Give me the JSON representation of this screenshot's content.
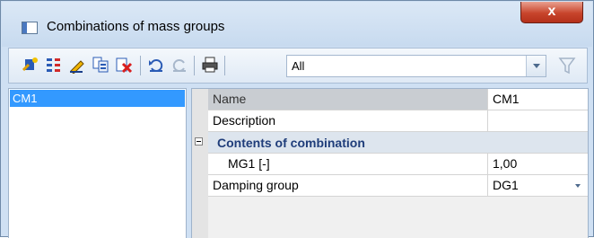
{
  "window": {
    "title": "Combinations of mass groups",
    "close_label": "x"
  },
  "toolbar": {
    "icons": [
      "new-item-icon",
      "insert-icon",
      "edit-icon",
      "copy-icon",
      "delete-icon",
      "undo-icon",
      "redo-icon",
      "print-icon",
      "filter-icon"
    ],
    "filter_value": "All"
  },
  "list": {
    "items": [
      "CM1"
    ],
    "selected": "CM1"
  },
  "properties": {
    "name_label": "Name",
    "name_value": "CM1",
    "description_label": "Description",
    "description_value": "",
    "group_label": "Contents of combination",
    "mg1_label": "MG1 [-]",
    "mg1_value": "1,00",
    "damping_label": "Damping group",
    "damping_value": "DG1"
  }
}
